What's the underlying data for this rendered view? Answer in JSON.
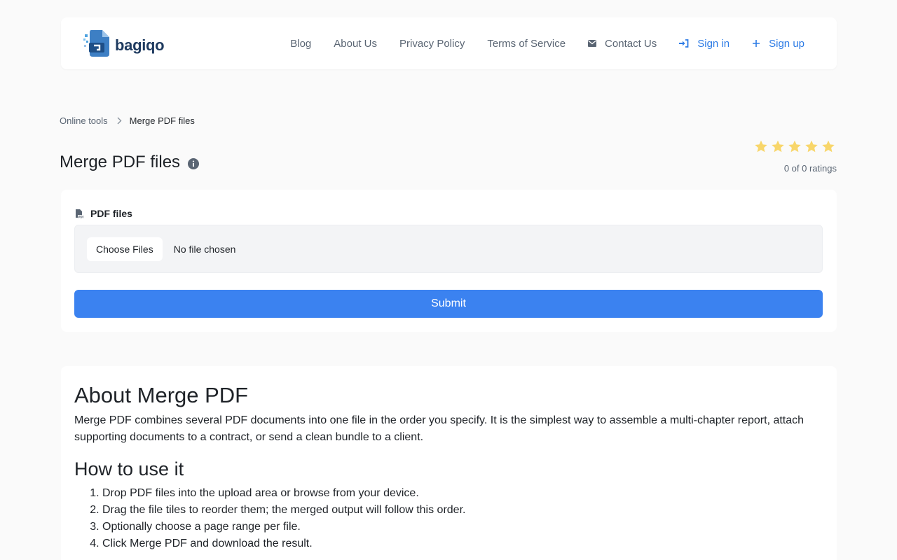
{
  "brand": {
    "name": "bagiqo",
    "logo_icon": "document-logo-icon"
  },
  "nav": {
    "items": [
      {
        "label": "Blog"
      },
      {
        "label": "About Us"
      },
      {
        "label": "Privacy Policy"
      },
      {
        "label": "Terms of Service"
      },
      {
        "label": "Contact Us",
        "icon": "envelope-icon"
      },
      {
        "label": "Sign in",
        "icon": "sign-in-icon"
      },
      {
        "label": "Sign up",
        "icon": "plus-icon"
      }
    ]
  },
  "breadcrumb": {
    "parent": "Online tools",
    "current": "Merge PDF files"
  },
  "page": {
    "title": "Merge PDF files",
    "info_icon": "info-icon"
  },
  "rating": {
    "stars": 5,
    "filled": 0,
    "text": "0 of 0 ratings",
    "star_color": "#f8d66a"
  },
  "form": {
    "field_label": "PDF files",
    "field_icon": "pdf-file-icon",
    "choose_label": "Choose Files",
    "file_status": "No file chosen",
    "submit_label": "Submit"
  },
  "about": {
    "title": "About Merge PDF",
    "body": "Merge PDF combines several PDF documents into one file in the order you specify. It is the simplest way to assemble a multi-chapter report, attach supporting documents to a contract, or send a clean bundle to a client.",
    "howto_title": "How to use it",
    "steps": [
      "Drop PDF files into the upload area or browse from your device.",
      "Drag the file tiles to reorder them; the merged output will follow this order.",
      "Optionally choose a page range per file.",
      "Click Merge PDF and download the result."
    ]
  },
  "colors": {
    "accent": "#2c7be5",
    "submit": "#3b82f0",
    "page_bg": "#fafafa"
  }
}
